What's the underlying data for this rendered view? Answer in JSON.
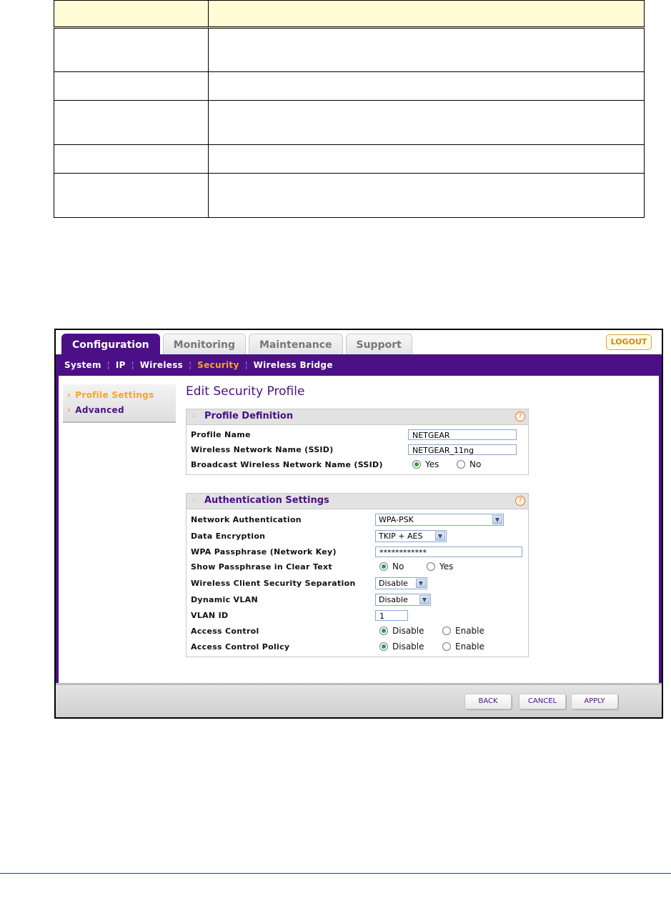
{
  "tabs": [
    {
      "label": "Configuration"
    },
    {
      "label": "Monitoring"
    },
    {
      "label": "Maintenance"
    },
    {
      "label": "Support"
    }
  ],
  "logout_label": "LOGOUT",
  "subnav": [
    {
      "label": "System"
    },
    {
      "label": "IP"
    },
    {
      "label": "Wireless"
    },
    {
      "label": "Security"
    },
    {
      "label": "Wireless Bridge"
    }
  ],
  "sidebar": [
    {
      "label": "Profile Settings"
    },
    {
      "label": "Advanced"
    }
  ],
  "page_title": "Edit Security Profile",
  "profile_definition": {
    "title": "Profile Definition",
    "profile_name_label": "Profile Name",
    "profile_name_value": "NETGEAR",
    "ssid_label": "Wireless Network Name (SSID)",
    "ssid_value": "NETGEAR_11ng",
    "broadcast_label": "Broadcast Wireless Network Name (SSID)",
    "broadcast_yes": "Yes",
    "broadcast_no": "No",
    "broadcast_selected": "Yes"
  },
  "authentication": {
    "title": "Authentication Settings",
    "network_auth_label": "Network Authentication",
    "network_auth_value": "WPA-PSK",
    "data_encryption_label": "Data Encryption",
    "data_encryption_value": "TKIP + AES",
    "passphrase_label": "WPA Passphrase (Network Key)",
    "passphrase_value": "************",
    "show_passphrase_label": "Show Passphrase in Clear Text",
    "show_no": "No",
    "show_yes": "Yes",
    "separation_label": "Wireless Client Security Separation",
    "separation_value": "Disable",
    "dynamic_vlan_label": "Dynamic VLAN",
    "dynamic_vlan_value": "Disable",
    "vlan_id_label": "VLAN ID",
    "vlan_id_value": "1",
    "access_control_label": "Access Control",
    "access_control_policy_label": "Access Control Policy",
    "disable_label": "Disable",
    "enable_label": "Enable"
  },
  "buttons": {
    "back": "BACK",
    "cancel": "CANCEL",
    "apply": "APPLY"
  }
}
